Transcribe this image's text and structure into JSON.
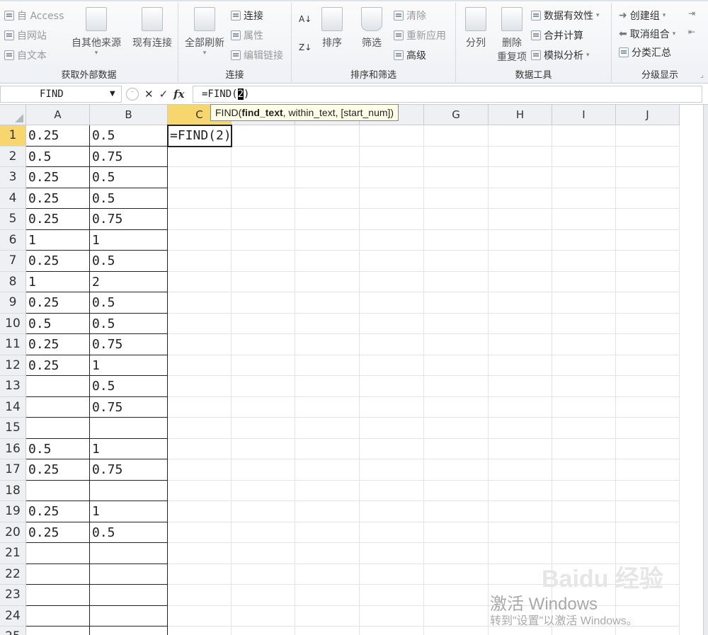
{
  "ribbon": {
    "external_data": {
      "from_access": "自 Access",
      "from_web": "自网站",
      "from_text": "自文本",
      "from_other": "自其他来源",
      "existing": "现有连接",
      "title": "获取外部数据"
    },
    "connections": {
      "refresh_all": "全部刷新",
      "connections": "连接",
      "properties": "属性",
      "edit_links": "编辑链接",
      "title": "连接"
    },
    "sort_filter": {
      "sort": "排序",
      "filter": "筛选",
      "clear": "清除",
      "reapply": "重新应用",
      "advanced": "高级",
      "title": "排序和筛选"
    },
    "data_tools": {
      "split": "分列",
      "remove_dup_1": "删除",
      "remove_dup_2": "重复项",
      "validation": "数据有效性",
      "consolidate": "合并计算",
      "what_if": "模拟分析",
      "title": "数据工具"
    },
    "outline": {
      "group": "创建组",
      "ungroup": "取消组合",
      "subtotal": "分类汇总",
      "title": "分级显示"
    }
  },
  "formula_bar": {
    "name_box": "FIND",
    "formula_before": "=FIND(",
    "formula_selected": "2",
    "formula_after": ")",
    "fx": "fx"
  },
  "tooltip": {
    "func": "FIND(",
    "arg1": "find_text",
    "rest": ", within_text, [start_num])"
  },
  "grid": {
    "columns": [
      "A",
      "B",
      "C",
      "D",
      "E",
      "F",
      "G",
      "H",
      "I",
      "J"
    ],
    "rows": [
      {
        "n": "1",
        "a": "0.25",
        "b": "0.5"
      },
      {
        "n": "2",
        "a": "0.5",
        "b": "0.75"
      },
      {
        "n": "3",
        "a": "0.25",
        "b": "0.5"
      },
      {
        "n": "4",
        "a": "0.25",
        "b": "0.5"
      },
      {
        "n": "5",
        "a": "0.25",
        "b": "0.75"
      },
      {
        "n": "6",
        "a": "1",
        "b": "1"
      },
      {
        "n": "7",
        "a": "0.25",
        "b": "0.5"
      },
      {
        "n": "8",
        "a": "1",
        "b": "2"
      },
      {
        "n": "9",
        "a": "0.25",
        "b": "0.5"
      },
      {
        "n": "10",
        "a": "0.5",
        "b": "0.5"
      },
      {
        "n": "11",
        "a": "0.25",
        "b": "0.75"
      },
      {
        "n": "12",
        "a": "0.25",
        "b": "1"
      },
      {
        "n": "13",
        "a": "",
        "b": "0.5"
      },
      {
        "n": "14",
        "a": "",
        "b": "0.75"
      },
      {
        "n": "15",
        "a": "",
        "b": ""
      },
      {
        "n": "16",
        "a": "0.5",
        "b": "1"
      },
      {
        "n": "17",
        "a": "0.25",
        "b": "0.75"
      },
      {
        "n": "18",
        "a": "",
        "b": ""
      },
      {
        "n": "19",
        "a": "0.25",
        "b": "1"
      },
      {
        "n": "20",
        "a": "0.25",
        "b": "0.5"
      },
      {
        "n": "21",
        "a": "",
        "b": ""
      },
      {
        "n": "22",
        "a": "",
        "b": ""
      },
      {
        "n": "23",
        "a": "",
        "b": ""
      },
      {
        "n": "24",
        "a": "",
        "b": ""
      },
      {
        "n": "25",
        "a": "",
        "b": ""
      }
    ],
    "active_cell_text": "=FIND(2)"
  },
  "watermark": {
    "title": "激活 Windows",
    "subtitle": "转到\"设置\"以激活 Windows。",
    "baidu": "Baidu 经验"
  },
  "colors": {
    "active_header": "#f7d76d",
    "ribbon_bg": "#eef1f5"
  }
}
